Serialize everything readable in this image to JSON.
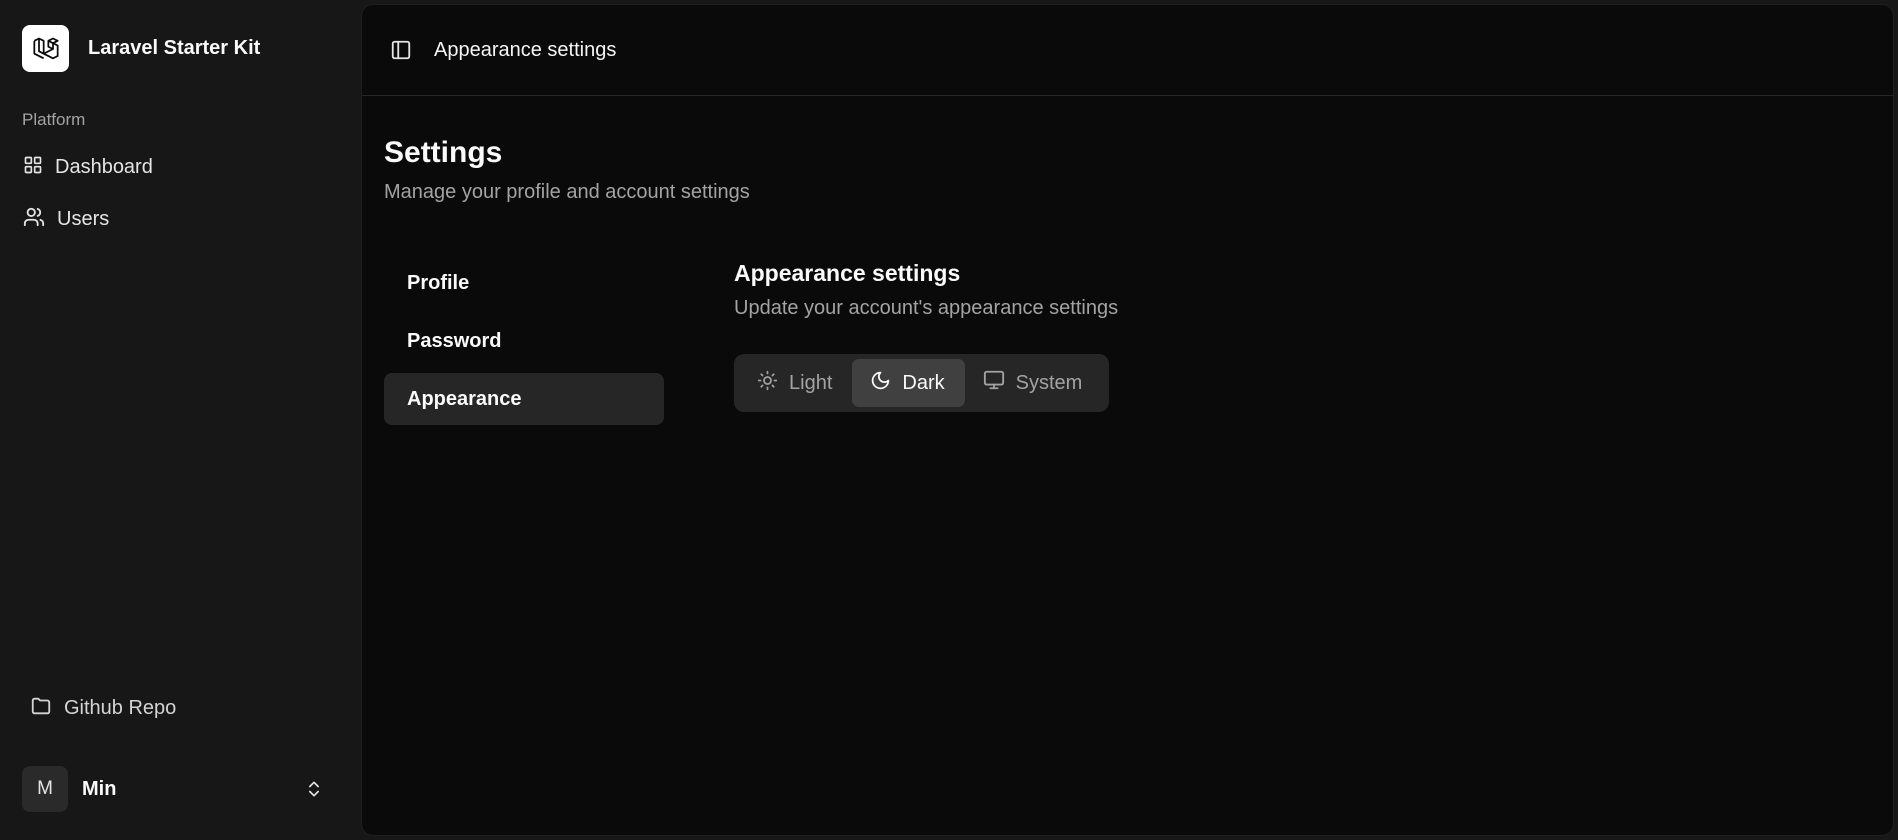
{
  "app": {
    "name": "Laravel Starter Kit"
  },
  "sidebar": {
    "group_label": "Platform",
    "items": [
      {
        "label": "Dashboard",
        "icon": "layout-grid-icon"
      },
      {
        "label": "Users",
        "icon": "users-icon"
      }
    ],
    "footer_link": {
      "label": "Github Repo",
      "icon": "folder-icon"
    },
    "user": {
      "initial": "M",
      "name": "Min"
    }
  },
  "header": {
    "breadcrumb": "Appearance settings"
  },
  "page": {
    "title": "Settings",
    "subtitle": "Manage your profile and account settings"
  },
  "settings_nav": [
    {
      "label": "Profile",
      "active": false
    },
    {
      "label": "Password",
      "active": false
    },
    {
      "label": "Appearance",
      "active": true
    }
  ],
  "appearance": {
    "title": "Appearance settings",
    "subtitle": "Update your account's appearance settings",
    "options": [
      {
        "label": "Light",
        "icon": "sun-icon"
      },
      {
        "label": "Dark",
        "icon": "moon-icon"
      },
      {
        "label": "System",
        "icon": "monitor-icon"
      }
    ],
    "selected": "Dark"
  },
  "colors": {
    "sidebar_bg": "#171717",
    "main_bg": "#0a0a0a",
    "active_bg": "#262626",
    "segment_active_bg": "#404040",
    "muted_text": "#a3a3a3"
  }
}
